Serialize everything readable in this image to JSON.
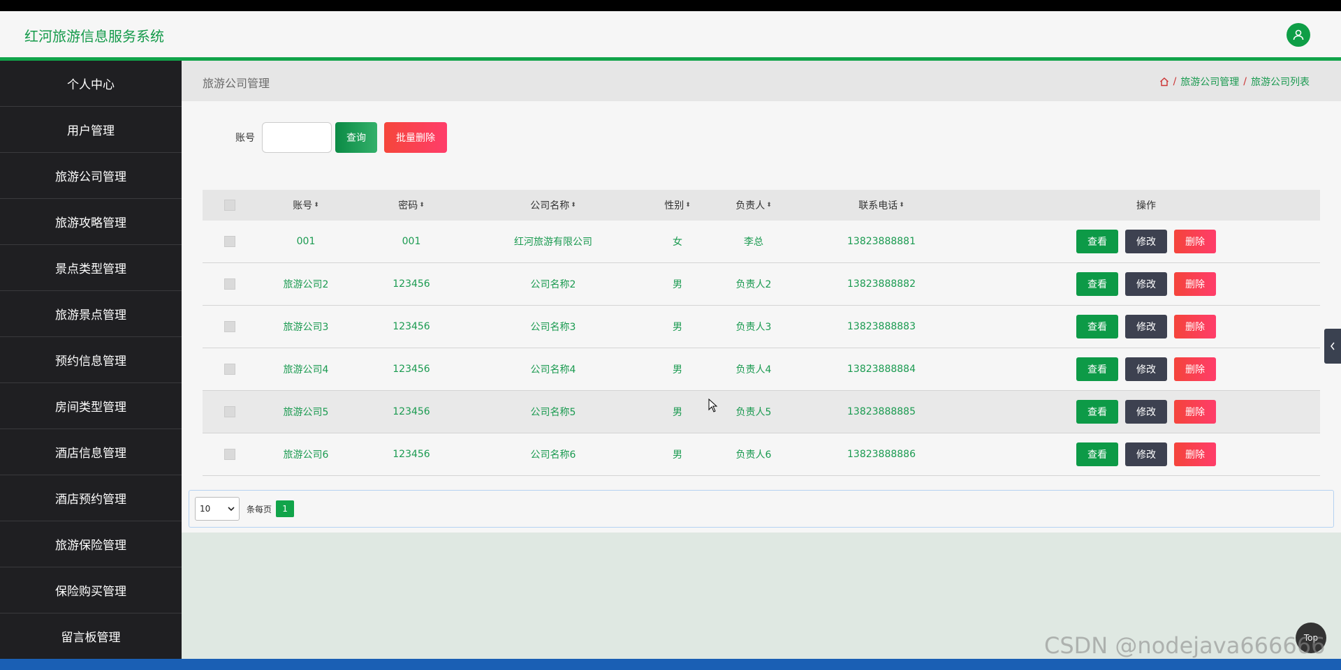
{
  "header": {
    "title": "红河旅游信息服务系统",
    "user_icon": "user-icon"
  },
  "sidebar": {
    "items": [
      {
        "label": "个人中心"
      },
      {
        "label": "用户管理"
      },
      {
        "label": "旅游公司管理"
      },
      {
        "label": "旅游攻略管理"
      },
      {
        "label": "景点类型管理"
      },
      {
        "label": "旅游景点管理"
      },
      {
        "label": "预约信息管理"
      },
      {
        "label": "房间类型管理"
      },
      {
        "label": "酒店信息管理"
      },
      {
        "label": "酒店预约管理"
      },
      {
        "label": "旅游保险管理"
      },
      {
        "label": "保险购买管理"
      },
      {
        "label": "留言板管理"
      }
    ]
  },
  "breadcrumb": {
    "page_name": "旅游公司管理",
    "home_icon": "home-icon",
    "crumb1": "旅游公司管理",
    "crumb2": "旅游公司列表",
    "sep": "/"
  },
  "search": {
    "label": "账号",
    "value": "",
    "query_button": "查询",
    "batch_delete_button": "批量删除"
  },
  "table": {
    "columns": [
      "账号",
      "密码",
      "公司名称",
      "性别",
      "负责人",
      "联系电话",
      "操作"
    ],
    "rows": [
      {
        "account": "001",
        "password": "001",
        "company": "红河旅游有限公司",
        "sex": "女",
        "manager": "李总",
        "phone": "13823888881"
      },
      {
        "account": "旅游公司2",
        "password": "123456",
        "company": "公司名称2",
        "sex": "男",
        "manager": "负责人2",
        "phone": "13823888882"
      },
      {
        "account": "旅游公司3",
        "password": "123456",
        "company": "公司名称3",
        "sex": "男",
        "manager": "负责人3",
        "phone": "13823888883"
      },
      {
        "account": "旅游公司4",
        "password": "123456",
        "company": "公司名称4",
        "sex": "男",
        "manager": "负责人4",
        "phone": "13823888884"
      },
      {
        "account": "旅游公司5",
        "password": "123456",
        "company": "公司名称5",
        "sex": "男",
        "manager": "负责人5",
        "phone": "13823888885"
      },
      {
        "account": "旅游公司6",
        "password": "123456",
        "company": "公司名称6",
        "sex": "男",
        "manager": "负责人6",
        "phone": "13823888886"
      }
    ],
    "actions": {
      "view": "查看",
      "edit": "修改",
      "delete": "删除"
    }
  },
  "pager": {
    "page_size": "10",
    "per_page_label": "条每页",
    "current_page": "1"
  },
  "misc": {
    "top_button": "Top",
    "watermark": "CSDN @nodejava666666",
    "collapse_icon": "chevron-left-icon"
  },
  "colors": {
    "brand": "#11a44a",
    "danger": "#f4443b",
    "dark": "#3d4150",
    "sidebar": "#1f1f22"
  }
}
